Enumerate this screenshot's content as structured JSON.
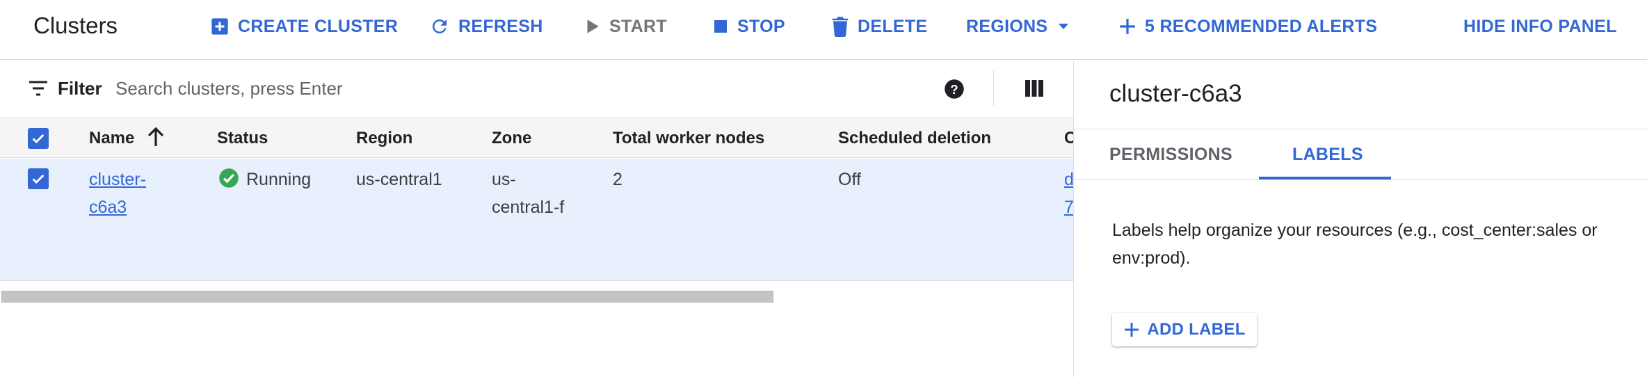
{
  "header": {
    "title": "Clusters",
    "hide_info_panel": "HIDE INFO PANEL"
  },
  "toolbar": {
    "create_cluster": "CREATE CLUSTER",
    "refresh": "REFRESH",
    "start": "START",
    "stop": "STOP",
    "delete": "DELETE",
    "regions": "REGIONS",
    "recommended_alerts": "5 RECOMMENDED ALERTS"
  },
  "filter": {
    "label": "Filter",
    "placeholder": "Search clusters, press Enter"
  },
  "table": {
    "columns": [
      "Name",
      "Status",
      "Region",
      "Zone",
      "Total worker nodes",
      "Scheduled deletion",
      "C"
    ],
    "rows": [
      {
        "name_line1": "cluster-",
        "name_line2": "c6a3",
        "status": "Running",
        "region": "us-central1",
        "zone_line1": "us-",
        "zone_line2": "central1-f",
        "total_worker_nodes": "2",
        "scheduled_deletion": "Off",
        "cloud_storage_line1": "d",
        "cloud_storage_line2": "7"
      }
    ]
  },
  "info_panel": {
    "title": "cluster-c6a3",
    "tabs": [
      "PERMISSIONS",
      "LABELS"
    ],
    "active_tab": "LABELS",
    "description": "Labels help organize your resources (e.g., cost_center:sales or env:prod).",
    "add_label": "ADD LABEL"
  },
  "colors": {
    "accent": "#3367d6",
    "selected_row": "#e8f0fe",
    "status_running": "#34a853"
  }
}
